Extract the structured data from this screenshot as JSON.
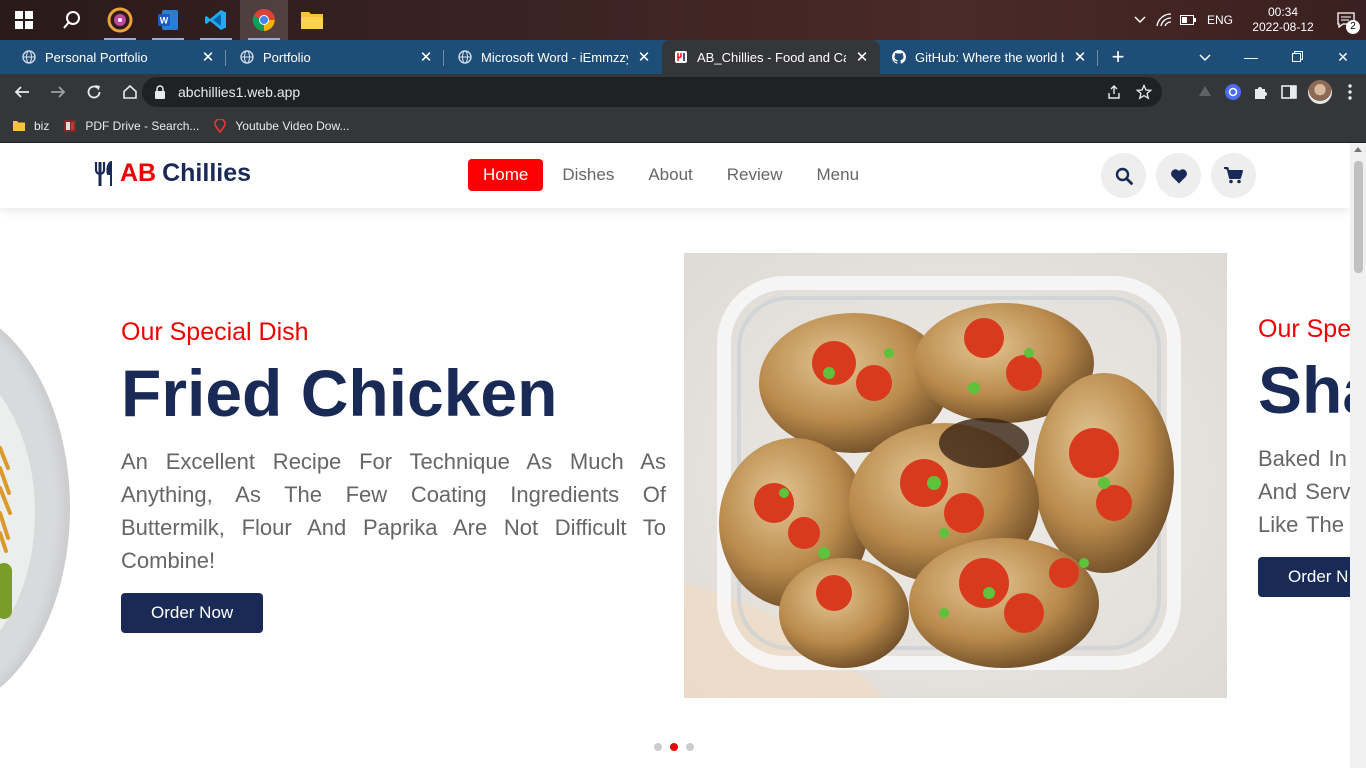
{
  "taskbar": {
    "apps": [
      "start-icon",
      "search-icon",
      "media-app-icon",
      "word-icon",
      "vscode-icon",
      "chrome-icon",
      "file-explorer-icon"
    ],
    "tray": {
      "language": "ENG",
      "time": "00:34",
      "date": "2022-08-12",
      "notifications": "2"
    }
  },
  "browser": {
    "tabs": [
      {
        "title": "Personal Portfolio"
      },
      {
        "title": "Portfolio"
      },
      {
        "title": "Microsoft Word - iEmmzzyHo"
      },
      {
        "title": "AB_Chillies - Food and Caterin"
      },
      {
        "title": "GitHub: Where the world buil"
      }
    ],
    "url": "abchillies1.web.app",
    "bookmarks": [
      {
        "label": "biz"
      },
      {
        "label": "PDF Drive - Search..."
      },
      {
        "label": "Youtube Video Dow..."
      }
    ]
  },
  "site": {
    "logo_prefix": "AB",
    "logo_suffix": "Chillies",
    "nav": [
      {
        "label": "Home"
      },
      {
        "label": "Dishes"
      },
      {
        "label": "About"
      },
      {
        "label": "Review"
      },
      {
        "label": "Menu"
      }
    ],
    "header_icons": [
      "search-icon",
      "heart-icon",
      "cart-icon"
    ],
    "slides": [
      {
        "subtitle": "Our Special Dish",
        "title": "Fried Chicken",
        "description": "An Excellent Recipe For Technique As Much As Anything, As The Few Coating Ingredients Of Buttermilk, Flour And Paprika Are Not Difficult To Combine!",
        "button": "Order Now"
      },
      {
        "subtitle": "Our Spe",
        "title": "Sha",
        "description_lines": [
          "Baked In",
          "And Serv",
          "Like The I"
        ],
        "button": "Order N"
      }
    ],
    "pagination": {
      "count": 3,
      "active": 2
    }
  },
  "colors": {
    "accent": "#ff0000",
    "brand": "#192a56",
    "tabbar": "#1e4d78"
  }
}
